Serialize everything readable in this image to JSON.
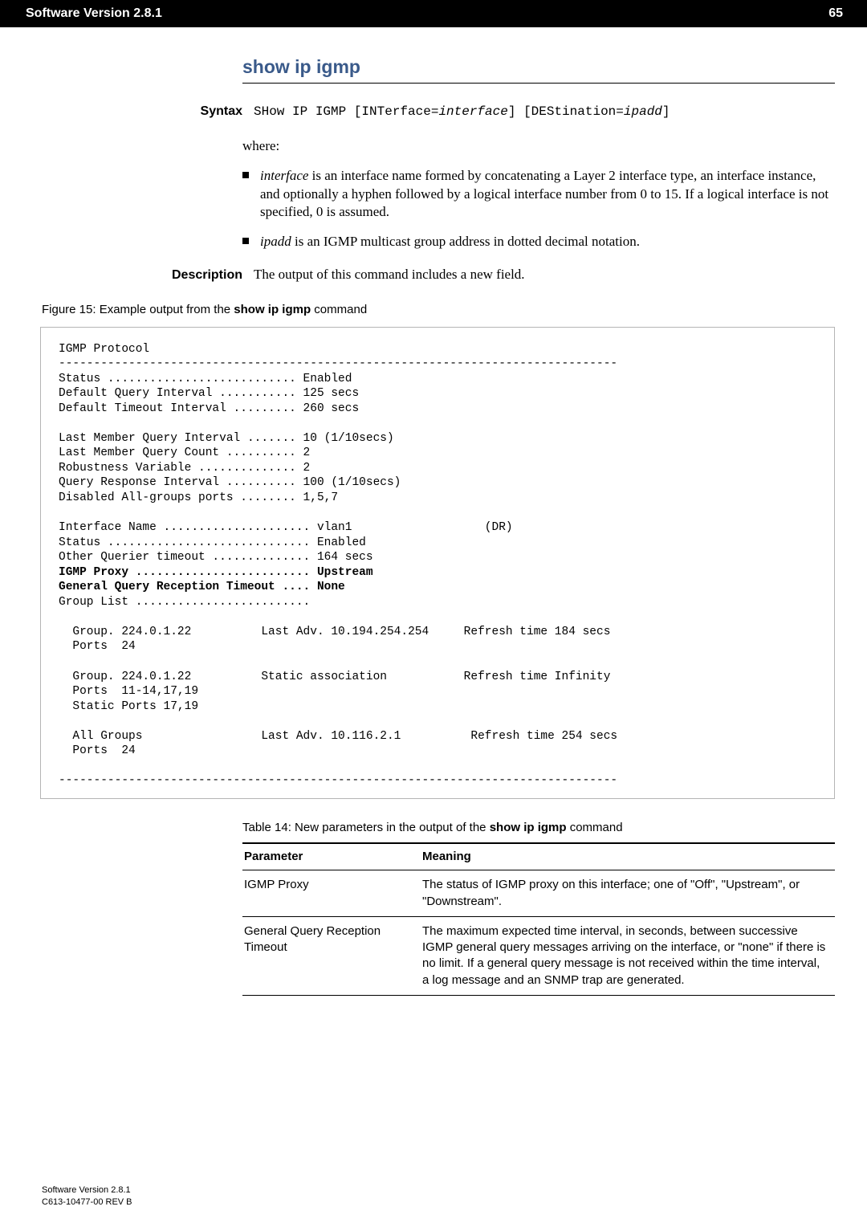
{
  "header": {
    "left": "Software Version 2.8.1",
    "right": "65"
  },
  "heading": "show ip igmp",
  "syntax": {
    "label": "Syntax",
    "command_prefix": "SHow IP IGMP [INTerface=",
    "iface_var": "interface",
    "middle": "] [DEStination=",
    "ipadd_var": "ipadd",
    "suffix": "]",
    "where": "where:",
    "bullets": {
      "b1_pre": "interface",
      "b1_rest": " is an interface name formed by concatenating a Layer 2 interface type, an interface instance, and optionally a hyphen followed by a logical interface number from 0 to 15. If a logical interface is not specified, 0 is assumed.",
      "b2_pre": "ipadd",
      "b2_rest": " is an IGMP multicast group address in dotted decimal notation."
    }
  },
  "description": {
    "label": "Description",
    "text": "The output of this command includes a new field."
  },
  "figure_caption": {
    "pre": "Figure 15: Example output from the ",
    "bold": "show ip igmp",
    "post": " command"
  },
  "terminal": {
    "title": "IGMP Protocol",
    "hr": "--------------------------------------------------------------------------------",
    "l_status": "Status ........................... Enabled",
    "l_dqi": "Default Query Interval ........... 125 secs",
    "l_dti": "Default Timeout Interval ......... 260 secs",
    "l_lmqi": "Last Member Query Interval ....... 10 (1/10secs)",
    "l_lmqc": "Last Member Query Count .......... 2",
    "l_rv": "Robustness Variable .............. 2",
    "l_qri": "Query Response Interval .......... 100 (1/10secs)",
    "l_dag": "Disabled All-groups ports ........ 1,5,7",
    "l_ifname": "Interface Name ..................... vlan1                   (DR)",
    "l_status2": "Status ............................. Enabled",
    "l_oqt": "Other Querier timeout .............. 164 secs",
    "l_proxy": "IGMP Proxy ......................... Upstream",
    "l_gqrt": "General Query Reception Timeout .... None",
    "l_gl": "Group List .........................",
    "g1_line": "  Group. 224.0.1.22          Last Adv. 10.194.254.254     Refresh time 184 secs",
    "g1_ports": "  Ports  24",
    "g2_line": "  Group. 224.0.1.22          Static association           Refresh time Infinity",
    "g2_ports": "  Ports  11-14,17,19",
    "g2_sports": "  Static Ports 17,19",
    "g3_line": "  All Groups                 Last Adv. 10.116.2.1          Refresh time 254 secs",
    "g3_ports": "  Ports  24"
  },
  "table": {
    "caption_pre": "Table 14: New parameters in the output of the ",
    "caption_bold": "show ip igmp",
    "caption_post": " command",
    "head_param": "Parameter",
    "head_meaning": "Meaning",
    "rows": [
      {
        "param": "IGMP Proxy",
        "meaning": "The status of IGMP proxy on this interface; one of \"Off\", \"Upstream\", or \"Downstream\"."
      },
      {
        "param": "General Query Reception Timeout",
        "meaning": "The maximum expected time interval, in seconds, between successive IGMP general query messages arriving on the interface, or \"none\" if there is no limit. If a general query message is not received within the time interval, a log message and an SNMP trap are generated."
      }
    ]
  },
  "footer": {
    "l1": "Software Version 2.8.1",
    "l2": "C613-10477-00 REV B"
  }
}
